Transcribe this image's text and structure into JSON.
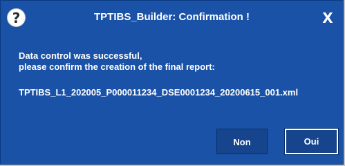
{
  "window": {
    "title": "TPTIBS_Builder: Confirmation !",
    "close_label": "X",
    "help_glyph": "?",
    "help_icon": "question-icon"
  },
  "message": {
    "line1": "Data control was successful,",
    "line2": "please confirm the creation of the final report:",
    "filename": "TPTIBS_L1_202005_P000011234_DSE0001234_20200615_001.xml"
  },
  "buttons": {
    "no_label": "Non",
    "yes_label": "Oui"
  },
  "colors": {
    "background": "#1a52a8",
    "button": "#16458e",
    "text": "#ffffff"
  }
}
